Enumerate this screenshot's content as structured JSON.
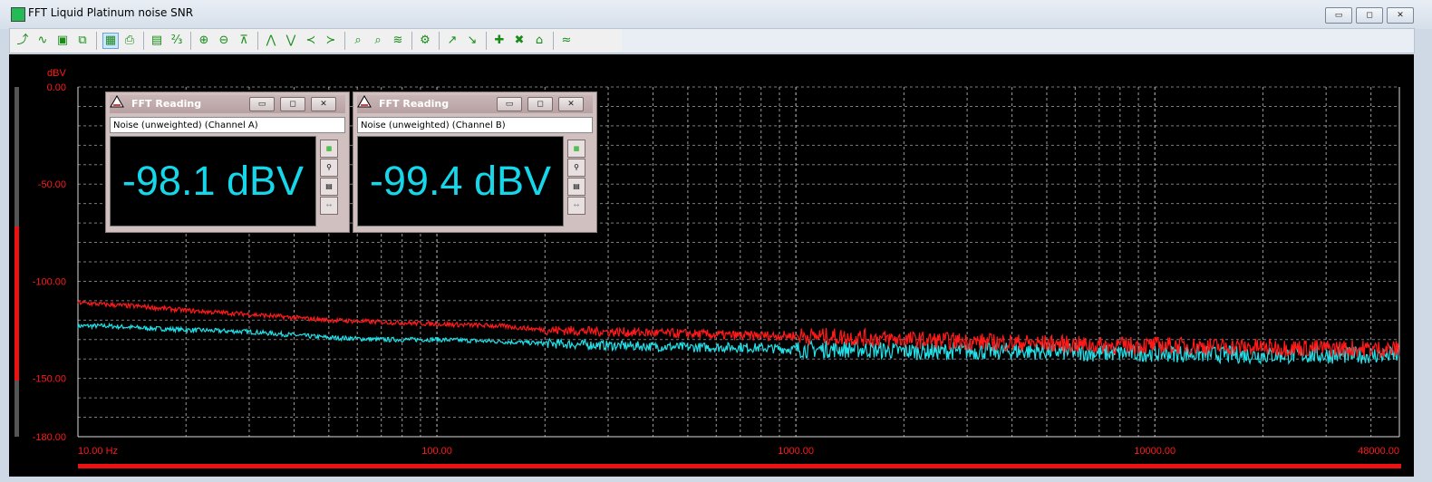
{
  "window": {
    "title": "FFT Liquid Platinum noise SNR",
    "controls": {
      "minimize": "▭",
      "maximize": "◻",
      "close": "✕"
    }
  },
  "toolbar": [
    {
      "name": "add-trace-icon",
      "glyph": "⤴"
    },
    {
      "name": "wave-icon",
      "glyph": "∿"
    },
    {
      "name": "save-icon",
      "glyph": "▣"
    },
    {
      "name": "copy-icon",
      "glyph": "⧉"
    },
    {
      "name": "graph-icon",
      "glyph": "▦"
    },
    {
      "name": "print-icon",
      "glyph": "⎙"
    },
    {
      "name": "calendar-icon",
      "glyph": "▤"
    },
    {
      "name": "digits-icon",
      "glyph": "⅔"
    },
    {
      "name": "zoom-in-icon",
      "glyph": "⊕"
    },
    {
      "name": "zoom-out-icon",
      "glyph": "⊖"
    },
    {
      "name": "fit-icon",
      "glyph": "⊼"
    },
    {
      "name": "peak-up-icon",
      "glyph": "⋀"
    },
    {
      "name": "peak-down-icon",
      "glyph": "⋁"
    },
    {
      "name": "peak-left-icon",
      "glyph": "≺"
    },
    {
      "name": "peak-right-icon",
      "glyph": "≻"
    },
    {
      "name": "marker-a-icon",
      "glyph": "⌕"
    },
    {
      "name": "marker-b-icon",
      "glyph": "⌕"
    },
    {
      "name": "overlay-icon",
      "glyph": "≋"
    },
    {
      "name": "settings-icon",
      "glyph": "⚙"
    },
    {
      "name": "cursor-a-icon",
      "glyph": "↗"
    },
    {
      "name": "cursor-b-icon",
      "glyph": "↘"
    },
    {
      "name": "add-marker-icon",
      "glyph": "✚"
    },
    {
      "name": "delete-marker-icon",
      "glyph": "✖"
    },
    {
      "name": "house-icon",
      "glyph": "⌂"
    },
    {
      "name": "wave-compare-icon",
      "glyph": "≈"
    },
    {
      "name": "stats-icon",
      "glyph": "⌗"
    }
  ],
  "plot": {
    "y_unit": "dBV",
    "y_ticks": [
      "0.00",
      "-50.00",
      "-100.00",
      "-150.00",
      "-180.00"
    ],
    "x_ticks": [
      "10.00 Hz",
      "100.00",
      "1000.00",
      "10000.00",
      "48000.00"
    ],
    "colors": {
      "channel_a": "#ff1a1a",
      "channel_b": "#22e0e8",
      "grid": "#cfcfcf",
      "axis_text": "#ff1a1a"
    }
  },
  "readings": [
    {
      "title": "FFT Reading",
      "caption": "Noise (unweighted) (Channel A)",
      "value": "-98.1 dBV"
    },
    {
      "title": "FFT Reading",
      "caption": "Noise (unweighted) (Channel B)",
      "value": "-99.4 dBV"
    }
  ],
  "chart_data": {
    "type": "line",
    "x_scale": "log",
    "xlim": [
      10,
      48000
    ],
    "ylim": [
      -180,
      0
    ],
    "ylabel": "dBV",
    "series": [
      {
        "x": [
          10,
          12,
          15,
          20,
          30,
          50,
          70,
          100,
          150,
          200,
          300,
          500,
          700,
          1000,
          1500,
          2000,
          3000,
          5000,
          7000,
          10000,
          20000,
          48000
        ],
        "values": [
          -111,
          -112,
          -113,
          -115,
          -117,
          -120,
          -121,
          -122,
          -123,
          -125,
          -126,
          -127,
          -128,
          -128,
          -129,
          -130,
          -131,
          -132,
          -133,
          -133,
          -134,
          -135
        ]
      },
      {
        "x": [
          10,
          12,
          15,
          20,
          30,
          50,
          70,
          100,
          150,
          200,
          300,
          500,
          700,
          1000,
          1500,
          2000,
          3000,
          5000,
          7000,
          10000,
          20000,
          48000
        ],
        "values": [
          -123,
          -123,
          -124,
          -125,
          -126,
          -129,
          -130,
          -130,
          -131,
          -132,
          -133,
          -134,
          -134,
          -135,
          -135,
          -136,
          -136,
          -136,
          -137,
          -137,
          -138,
          -138
        ]
      }
    ]
  }
}
